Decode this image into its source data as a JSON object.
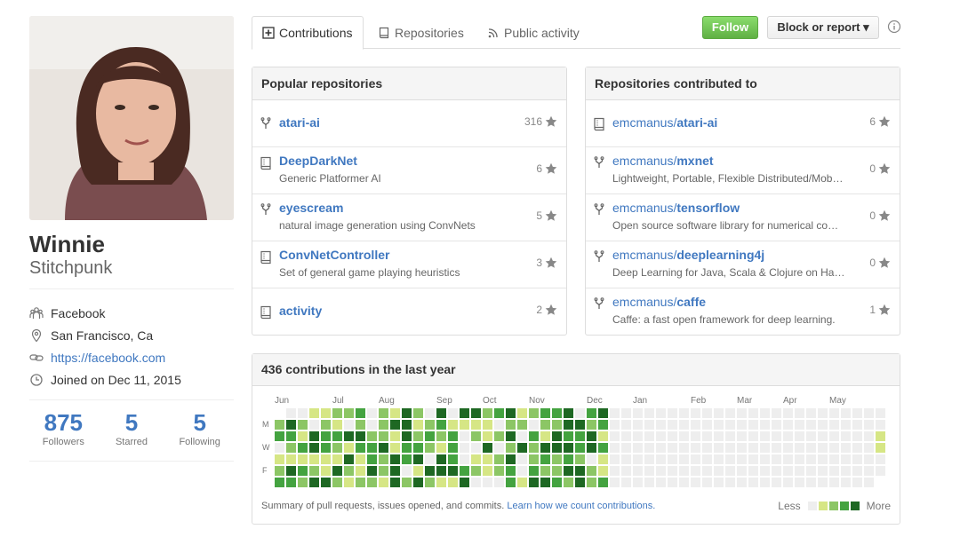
{
  "profile": {
    "name": "Winnie",
    "login": "Stitchpunk",
    "company": "Facebook",
    "location": "San Francisco, Ca",
    "url": "https://facebook.com",
    "joined": "Joined on Dec 11, 2015",
    "stats": [
      {
        "value": "875",
        "label": "Followers"
      },
      {
        "value": "5",
        "label": "Starred"
      },
      {
        "value": "5",
        "label": "Following"
      }
    ]
  },
  "tabs": [
    {
      "label": "Contributions",
      "icon": "plus-square-icon",
      "selected": true
    },
    {
      "label": "Repositories",
      "icon": "repo-icon",
      "selected": false
    },
    {
      "label": "Public activity",
      "icon": "rss-icon",
      "selected": false
    }
  ],
  "actions": {
    "follow": "Follow",
    "block": "Block or report ▾"
  },
  "popular": {
    "title": "Popular repositories",
    "items": [
      {
        "name": "atari-ai",
        "desc": "",
        "stars": "316",
        "icon": "fork-icon"
      },
      {
        "name": "DeepDarkNet",
        "desc": "Generic Platformer AI",
        "stars": "6",
        "icon": "repo-icon"
      },
      {
        "name": "eyescream",
        "desc": "natural image generation using ConvNets",
        "stars": "5",
        "icon": "fork-icon"
      },
      {
        "name": "ConvNetController",
        "desc": "Set of general game playing heuristics",
        "stars": "3",
        "icon": "repo-icon"
      },
      {
        "name": "activity",
        "desc": "",
        "stars": "2",
        "icon": "repo-icon"
      }
    ]
  },
  "contributed": {
    "title": "Repositories contributed to",
    "items": [
      {
        "owner": "emcmanus/",
        "name": "atari-ai",
        "desc": "",
        "stars": "6",
        "icon": "repo-icon"
      },
      {
        "owner": "emcmanus/",
        "name": "mxnet",
        "desc": "Lightweight, Portable, Flexible Distributed/Mob…",
        "stars": "0",
        "icon": "fork-icon"
      },
      {
        "owner": "emcmanus/",
        "name": "tensorflow",
        "desc": "Open source software library for numerical co…",
        "stars": "0",
        "icon": "fork-icon"
      },
      {
        "owner": "emcmanus/",
        "name": "deeplearning4j",
        "desc": "Deep Learning for Java, Scala & Clojure on Ha…",
        "stars": "0",
        "icon": "fork-icon"
      },
      {
        "owner": "emcmanus/",
        "name": "caffe",
        "desc": "Caffe: a fast open framework for deep learning.",
        "stars": "1",
        "icon": "fork-icon"
      }
    ]
  },
  "contributions": {
    "title": "436 contributions in the last year",
    "months": [
      "Jun",
      "Jul",
      "Aug",
      "Sep",
      "Oct",
      "Nov",
      "Dec",
      "Jan",
      "Feb",
      "Mar",
      "Apr",
      "May"
    ],
    "weekdays": [
      "M",
      "W",
      "F"
    ],
    "summary": "Summary of pull requests, issues opened, and commits.",
    "learn_link": "Learn how we count contributions.",
    "less": "Less",
    "more": "More",
    "colors": [
      "#eeeeee",
      "#d6e685",
      "#8cc665",
      "#44a340",
      "#1e6823"
    ],
    "active_weeks": 29,
    "total_weeks": 53
  }
}
